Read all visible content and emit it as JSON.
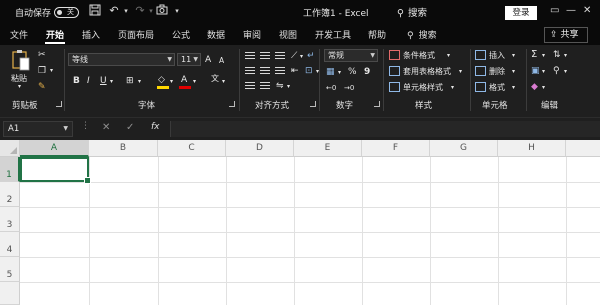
{
  "titlebar": {
    "autosave_label": "自动保存",
    "autosave_state": "关",
    "title": "工作簿1  -  Excel",
    "search_label": "搜索",
    "login_label": "登录",
    "icons": [
      "save-icon",
      "undo-icon",
      "redo-icon",
      "camera-icon",
      "search-icon"
    ]
  },
  "tabs": [
    {
      "label": "文件"
    },
    {
      "label": "开始",
      "active": true
    },
    {
      "label": "插入"
    },
    {
      "label": "页面布局"
    },
    {
      "label": "公式"
    },
    {
      "label": "数据"
    },
    {
      "label": "审阅"
    },
    {
      "label": "视图"
    },
    {
      "label": "开发工具"
    },
    {
      "label": "帮助"
    }
  ],
  "tell_me": "搜索",
  "share_label": "共享",
  "ribbon": {
    "clipboard": {
      "paste_label": "粘贴",
      "group_label": "剪贴板"
    },
    "font": {
      "font_name": "等线",
      "font_size": "11",
      "bold": "B",
      "italic": "I",
      "underline": "U",
      "grow": "A",
      "shrink": "A",
      "font_color_letter": "A",
      "highlight_color": "#ffd700",
      "font_color": "#e00000",
      "group_label": "字体"
    },
    "alignment": {
      "group_label": "对齐方式"
    },
    "number": {
      "format": "常规",
      "percent": "%",
      "comma": "9",
      "group_label": "数字"
    },
    "styles": {
      "conditional_format": "条件格式",
      "format_as_table": "套用表格格式",
      "cell_styles": "单元格样式",
      "group_label": "样式"
    },
    "cells": {
      "insert": "插入",
      "delete": "删除",
      "format": "格式",
      "group_label": "单元格"
    },
    "editing": {
      "sum": "Σ",
      "group_label": "编辑"
    }
  },
  "formula_bar": {
    "name_box": "A1",
    "cancel": "✕",
    "enter": "✓",
    "fx": "fx",
    "value": ""
  },
  "sheet": {
    "columns": [
      "A",
      "B",
      "C",
      "D",
      "E",
      "F",
      "G",
      "H"
    ],
    "rows": [
      "1",
      "2",
      "3",
      "4",
      "5"
    ],
    "selected_cell": "A1"
  }
}
